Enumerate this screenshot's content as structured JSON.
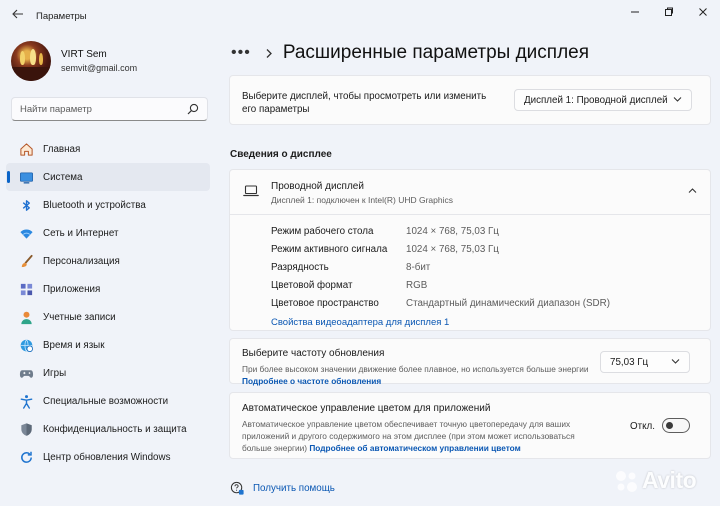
{
  "window": {
    "app_title": "Параметры"
  },
  "profile": {
    "name": "VIRT Sem",
    "email": "semvit@gmail.com"
  },
  "search": {
    "placeholder": "Найти параметр"
  },
  "sidebar": {
    "items": [
      {
        "label": "Главная",
        "icon": "home-icon"
      },
      {
        "label": "Система",
        "icon": "system-icon",
        "active": true
      },
      {
        "label": "Bluetooth и устройства",
        "icon": "bluetooth-icon"
      },
      {
        "label": "Сеть и Интернет",
        "icon": "wifi-icon"
      },
      {
        "label": "Персонализация",
        "icon": "brush-icon"
      },
      {
        "label": "Приложения",
        "icon": "apps-icon"
      },
      {
        "label": "Учетные записи",
        "icon": "account-icon"
      },
      {
        "label": "Время и язык",
        "icon": "globe-clock-icon"
      },
      {
        "label": "Игры",
        "icon": "gamepad-icon"
      },
      {
        "label": "Специальные возможности",
        "icon": "accessibility-icon"
      },
      {
        "label": "Конфиденциальность и защита",
        "icon": "shield-icon"
      },
      {
        "label": "Центр обновления Windows",
        "icon": "update-icon"
      }
    ]
  },
  "breadcrumb": {
    "dots": "•••",
    "title": "Расширенные параметры дисплея"
  },
  "display_select": {
    "text": "Выберите дисплей, чтобы просмотреть или изменить его параметры",
    "value": "Дисплей 1: Проводной дисплей"
  },
  "section": {
    "title": "Сведения о дисплее"
  },
  "display_info": {
    "title": "Проводной дисплей",
    "subtitle": "Дисплей 1: подключен к Intel(R) UHD Graphics",
    "rows": [
      {
        "key": "Режим рабочего стола",
        "value": "1024 × 768, 75,03 Гц"
      },
      {
        "key": "Режим активного сигнала",
        "value": "1024 × 768, 75,03 Гц"
      },
      {
        "key": "Разрядность",
        "value": "8-бит"
      },
      {
        "key": "Цветовой формат",
        "value": "RGB"
      },
      {
        "key": "Цветовое пространство",
        "value": "Стандартный динамический диапазон (SDR)"
      }
    ],
    "adapter_link": "Свойства видеоадаптера для дисплея 1"
  },
  "refresh": {
    "title": "Выберите частоту обновления",
    "desc": "При более высоком значении движение более плавное, но используется больше энергии",
    "link": "Подробнее о частоте обновления",
    "value": "75,03 Гц"
  },
  "color_mgmt": {
    "title": "Автоматическое управление цветом для приложений",
    "desc": "Автоматическое управление цветом обеспечивает точную цветопередачу для ваших приложений и другого содержимого на этом дисплее (при этом может использоваться больше энергии)",
    "link": "Подробнее об автоматическом управлении цветом",
    "toggle_label": "Откл.",
    "toggle_on": false
  },
  "help": {
    "label": "Получить помощь"
  },
  "watermark": {
    "text": "Avito"
  },
  "colors": {
    "accent": "#0a64c8",
    "link": "#0a57b3",
    "background": "#f0f3f9",
    "card": "#fbfbfb"
  }
}
